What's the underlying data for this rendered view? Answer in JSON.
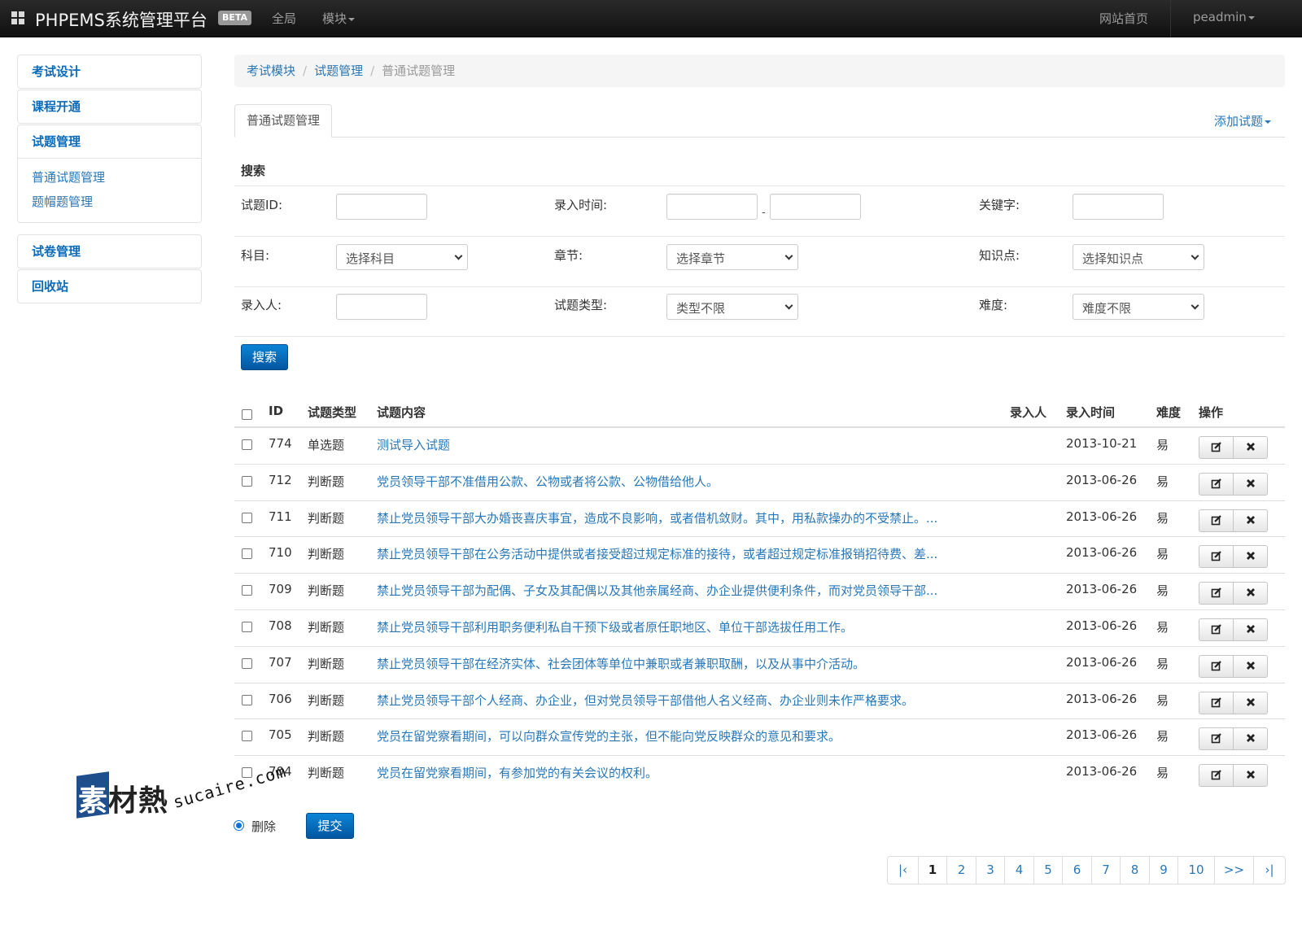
{
  "navbar": {
    "brand": "PHPEMS系统管理平台",
    "badge": "BETA",
    "links": [
      "全局",
      "模块"
    ],
    "right": {
      "home": "网站首页",
      "user": "peadmin"
    }
  },
  "sidebar": {
    "items": [
      {
        "label": "考试设计"
      },
      {
        "label": "课程开通"
      },
      {
        "label": "试题管理",
        "children": [
          "普通试题管理",
          "题帽题管理"
        ]
      },
      {
        "label": "试卷管理"
      },
      {
        "label": "回收站"
      }
    ]
  },
  "breadcrumb": [
    "考试模块",
    "试题管理",
    "普通试题管理"
  ],
  "tabs": {
    "active": "普通试题管理",
    "add": "添加试题"
  },
  "search": {
    "heading": "搜索",
    "labels": {
      "id": "试题ID:",
      "time": "录入时间:",
      "keyword": "关键字:",
      "subject": "科目:",
      "chapter": "章节:",
      "point": "知识点:",
      "author": "录入人:",
      "type": "试题类型:",
      "difficulty": "难度:"
    },
    "selects": {
      "subject": "选择科目",
      "chapter": "选择章节",
      "point": "选择知识点",
      "type": "类型不限",
      "difficulty": "难度不限"
    },
    "time_sep": "-",
    "button": "搜索"
  },
  "table": {
    "headers": [
      "ID",
      "试题类型",
      "试题内容",
      "录入人",
      "录入时间",
      "难度",
      "操作"
    ],
    "rows": [
      {
        "id": "774",
        "type": "单选题",
        "content": "测试导入试题",
        "author": "",
        "date": "2013-10-21",
        "difficulty": "易"
      },
      {
        "id": "712",
        "type": "判断题",
        "content": "党员领导干部不准借用公款、公物或者将公款、公物借给他人。",
        "author": "",
        "date": "2013-06-26",
        "difficulty": "易"
      },
      {
        "id": "711",
        "type": "判断题",
        "content": "禁止党员领导干部大办婚丧喜庆事宜，造成不良影响，或者借机敛财。其中，用私款操办的不受禁止。...",
        "author": "",
        "date": "2013-06-26",
        "difficulty": "易"
      },
      {
        "id": "710",
        "type": "判断题",
        "content": "禁止党员领导干部在公务活动中提供或者接受超过规定标准的接待，或者超过规定标准报销招待费、差...",
        "author": "",
        "date": "2013-06-26",
        "difficulty": "易"
      },
      {
        "id": "709",
        "type": "判断题",
        "content": "禁止党员领导干部为配偶、子女及其配偶以及其他亲属经商、办企业提供便利条件，而对党员领导干部...",
        "author": "",
        "date": "2013-06-26",
        "difficulty": "易"
      },
      {
        "id": "708",
        "type": "判断题",
        "content": "禁止党员领导干部利用职务便利私自干预下级或者原任职地区、单位干部选拔任用工作。",
        "author": "",
        "date": "2013-06-26",
        "difficulty": "易"
      },
      {
        "id": "707",
        "type": "判断题",
        "content": "禁止党员领导干部在经济实体、社会团体等单位中兼职或者兼职取酬，以及从事中介活动。",
        "author": "",
        "date": "2013-06-26",
        "difficulty": "易"
      },
      {
        "id": "706",
        "type": "判断题",
        "content": "禁止党员领导干部个人经商、办企业，但对党员领导干部借他人名义经商、办企业则未作严格要求。",
        "author": "",
        "date": "2013-06-26",
        "difficulty": "易"
      },
      {
        "id": "705",
        "type": "判断题",
        "content": "党员在留党察看期间，可以向群众宣传党的主张，但不能向党反映群众的意见和要求。",
        "author": "",
        "date": "2013-06-26",
        "difficulty": "易"
      },
      {
        "id": "704",
        "type": "判断题",
        "content": "党员在留党察看期间，有参加党的有关会议的权利。",
        "author": "",
        "date": "2013-06-26",
        "difficulty": "易"
      }
    ],
    "row_icons": [
      "edit-icon",
      "delete-icon"
    ]
  },
  "actions": {
    "radio_label": "删除",
    "submit": "提交"
  },
  "pagination": {
    "first": "|‹",
    "pages": [
      "1",
      "2",
      "3",
      "4",
      "5",
      "6",
      "7",
      "8",
      "9",
      "10"
    ],
    "next": ">>",
    "last": "›|",
    "current": "1"
  },
  "watermark": {
    "cn": "素材熱",
    "url": "sucaire.com"
  },
  "colors": {
    "link": "#2a77b7",
    "primary": "#0a6ec2",
    "navbar": "#1b1b1b"
  }
}
